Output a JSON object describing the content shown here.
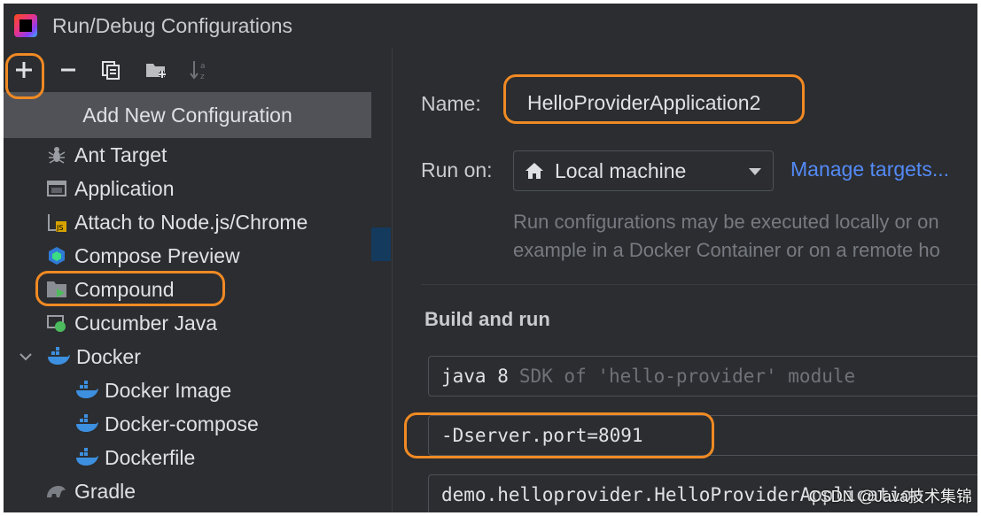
{
  "window": {
    "title": "Run/Debug Configurations"
  },
  "toolbar": {
    "add_icon": "plus-icon",
    "remove_icon": "minus-icon",
    "copy_icon": "copy-icon",
    "folder_icon": "new-folder-icon",
    "sort_icon": "sort-alpha-icon"
  },
  "add_new": {
    "label": "Add New Configuration"
  },
  "tree": {
    "items": [
      {
        "label": "Ant Target",
        "icon": "ant-icon"
      },
      {
        "label": "Application",
        "icon": "application-icon"
      },
      {
        "label": "Attach to Node.js/Chrome",
        "icon": "nodejs-icon"
      },
      {
        "label": "Compose Preview",
        "icon": "compose-icon"
      },
      {
        "label": "Compound",
        "icon": "compound-icon"
      },
      {
        "label": "Cucumber Java",
        "icon": "cucumber-icon"
      },
      {
        "label": "Docker",
        "icon": "docker-icon",
        "expanded": true
      },
      {
        "label": "Docker Image",
        "icon": "docker-icon"
      },
      {
        "label": "Docker-compose",
        "icon": "docker-icon"
      },
      {
        "label": "Dockerfile",
        "icon": "docker-icon"
      },
      {
        "label": "Gradle",
        "icon": "gradle-icon"
      }
    ]
  },
  "form": {
    "name_label": "Name:",
    "name_value": "HelloProviderApplication2",
    "run_on_label": "Run on:",
    "run_on_value": "Local machine",
    "manage_targets": "Manage targets...",
    "hint_line1": "Run configurations may be executed locally or on",
    "hint_line2": "example in a Docker Container or on a remote ho",
    "build_run_title": "Build and run",
    "sdk_value_prefix": "java 8",
    "sdk_value_suffix": "SDK of 'hello-provider' module",
    "vm_options": "-Dserver.port=8091",
    "main_class": "demo.helloprovider.HelloProviderApplication"
  },
  "watermark": "CSDN @Java技术集锦",
  "colors": {
    "background": "#2b2d30",
    "highlight": "#f08a24",
    "link": "#548af7",
    "selection_popup": "#505257"
  }
}
